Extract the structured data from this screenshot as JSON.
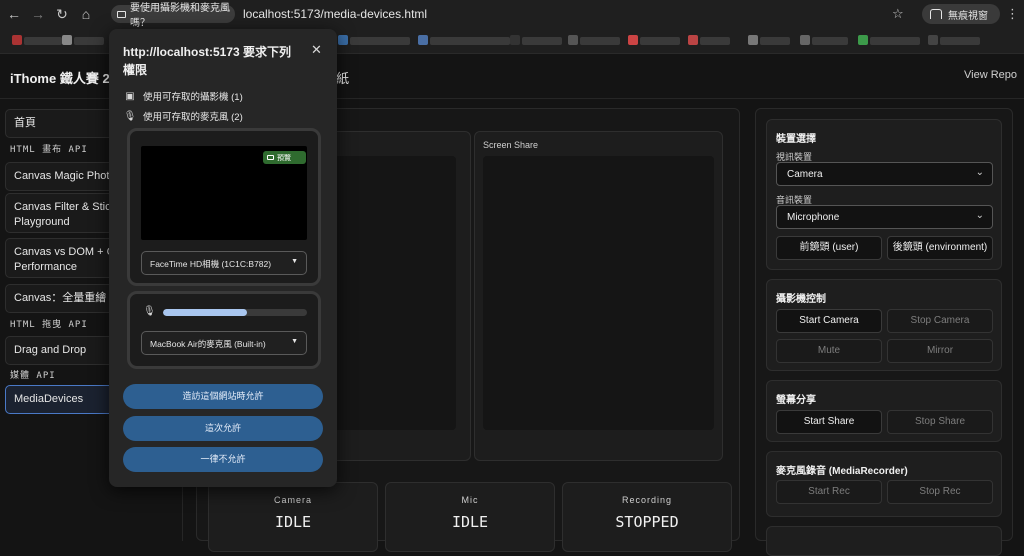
{
  "browser": {
    "permission_chip": "要使用攝影機和麥克風嗎？",
    "url": "localhost:5173/media-devices.html",
    "incognito_label": "無痕視窗"
  },
  "header": {
    "title": "iThome 鐵人賽 20",
    "title_tail": "紙",
    "view_repo": "View Repo"
  },
  "sidebar": {
    "home": "首頁",
    "cat_canvas": "HTML 畫布 API",
    "item_magic": "Canvas Magic Photo",
    "item_filter": "Canvas Filter & Sticker Playground",
    "item_dom": "Canvas vs DOM + CSS Performance",
    "item_redraw": "Canvas：全量重繪 vs",
    "cat_drag": "HTML 拖曳 API",
    "item_drag": "Drag and Drop",
    "cat_media": "媒體 API",
    "item_media": "MediaDevices"
  },
  "main": {
    "screen_share_label": "Screen Share",
    "stats": [
      {
        "label": "Camera",
        "value": "IDLE"
      },
      {
        "label": "Mic",
        "value": "IDLE"
      },
      {
        "label": "Recording",
        "value": "STOPPED"
      }
    ]
  },
  "device_panel": {
    "title": "裝置選擇",
    "video_label": "視訊裝置",
    "video_value": "Camera",
    "audio_label": "音訊裝置",
    "audio_value": "Microphone",
    "front_btn": "前鏡頭 (user)",
    "back_btn": "後鏡頭 (environment)"
  },
  "camera_panel": {
    "title": "攝影機控制",
    "start": "Start Camera",
    "stop": "Stop Camera",
    "mute": "Mute",
    "mirror": "Mirror"
  },
  "share_panel": {
    "title": "螢幕分享",
    "start": "Start Share",
    "stop": "Stop Share"
  },
  "rec_panel": {
    "title": "麥克風錄音 (MediaRecorder)",
    "start": "Start Rec",
    "stop": "Stop Rec"
  },
  "permission_popup": {
    "title": "http://localhost:5173 要求下列權限",
    "camera_line": "使用可存取的攝影機 (1)",
    "mic_line": "使用可存取的麥克風 (2)",
    "preview_badge": "預覽",
    "camera_device": "FaceTime HD相機 (1C1C:B782)",
    "mic_device": "MacBook Air的麥克風 (Built-in)",
    "mic_level": 0.58,
    "btn_allow_always": "造訪這個網站時允許",
    "btn_allow_once": "這次允許",
    "btn_never": "一律不允許"
  },
  "colors": {
    "accent": "#4a79c7",
    "popup_button": "#2d5f91",
    "meter_fill": "#a9c6ef",
    "preview_badge": "#2f6b2f"
  }
}
